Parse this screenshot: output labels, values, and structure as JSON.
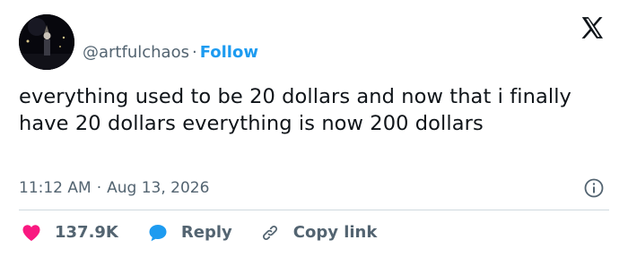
{
  "author": {
    "handle": "@artfulchaos",
    "separator": "·",
    "follow_label": "Follow"
  },
  "tweet": {
    "text": "everything used to be 20 dollars and now that i finally have 20 dollars everything is now 200 dollars",
    "time": "11:12 AM",
    "meta_separator": "·",
    "date": "Aug 13, 2026"
  },
  "actions": {
    "like_count": "137.9K",
    "reply_label": "Reply",
    "copy_link_label": "Copy link"
  },
  "icons": {
    "brand_logo": "x-logo-icon",
    "info": "info-icon",
    "like": "heart-icon",
    "reply": "speech-bubble-icon",
    "copy": "link-icon"
  },
  "colors": {
    "accent": "#1d9bf0",
    "like": "#f91880",
    "muted": "#536471",
    "text": "#0f1419",
    "divider": "#cfd9de"
  }
}
